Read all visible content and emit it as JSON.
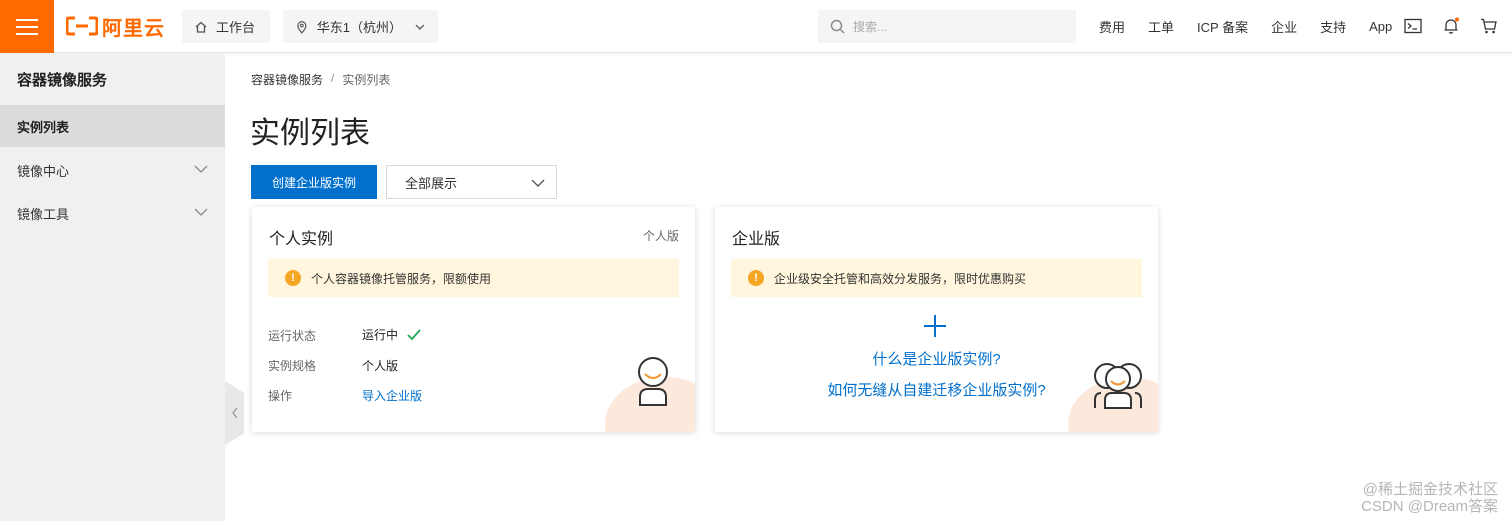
{
  "header": {
    "logo_text": "阿里云",
    "workbench": "工作台",
    "region": "华东1（杭州）",
    "search_placeholder": "搜索...",
    "nav": [
      "费用",
      "工单",
      "ICP 备案",
      "企业",
      "支持",
      "App"
    ],
    "brand_color": "#ff6a00"
  },
  "sidebar": {
    "title": "容器镜像服务",
    "items": [
      {
        "label": "实例列表",
        "active": true
      },
      {
        "label": "镜像中心",
        "active": false
      },
      {
        "label": "镜像工具",
        "active": false
      }
    ]
  },
  "main": {
    "breadcrumb": [
      "容器镜像服务",
      "实例列表"
    ],
    "breadcrumb_sep": "/",
    "title": "实例列表",
    "create_button": "创建企业版实例",
    "filter_select": "全部展示",
    "accent_color": "#0070cc"
  },
  "personal_card": {
    "title": "个人实例",
    "tag": "个人版",
    "notice": "个人容器镜像托管服务，限额使用",
    "rows": [
      {
        "label": "运行状态",
        "value": "运行中"
      },
      {
        "label": "实例规格",
        "value": "个人版"
      },
      {
        "label": "操作",
        "value": "导入企业版"
      }
    ]
  },
  "enterprise_card": {
    "title": "企业版",
    "notice": "企业级安全托管和高效分发服务，限时优惠购买",
    "links": [
      "什么是企业版实例?",
      "如何无缝从自建迁移企业版实例?"
    ]
  },
  "watermark": {
    "line1": "@稀土掘金技术社区",
    "line2": "CSDN @Dream答案"
  }
}
